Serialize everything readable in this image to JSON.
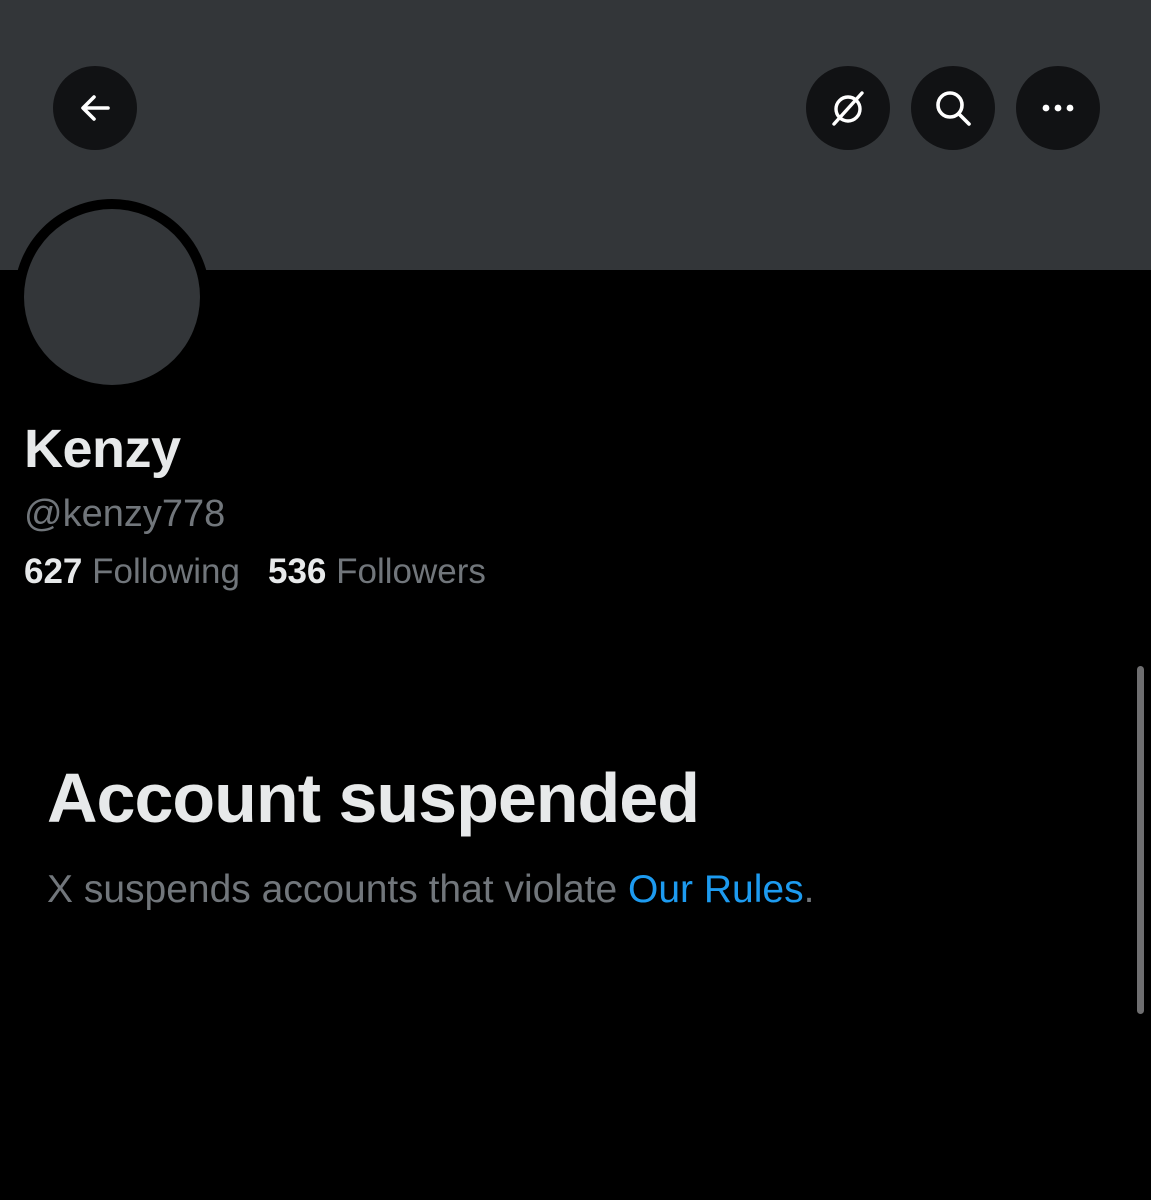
{
  "header": {
    "back_icon": "arrow-left-icon",
    "grok_icon": "grok-icon",
    "search_icon": "search-icon",
    "more_icon": "more-horizontal-icon"
  },
  "profile": {
    "display_name": "Kenzy",
    "handle": "@kenzy778",
    "following_count": "627",
    "following_label": "Following",
    "followers_count": "536",
    "followers_label": "Followers"
  },
  "suspension": {
    "title": "Account suspended",
    "message_prefix": "X suspends accounts that violate ",
    "rules_link": "Our Rules",
    "message_suffix": "."
  },
  "colors": {
    "background": "#000000",
    "banner": "#333639",
    "avatar": "#333639",
    "primary_text": "#e7e9ea",
    "secondary_text": "#71767b",
    "link": "#1d9bf0"
  }
}
